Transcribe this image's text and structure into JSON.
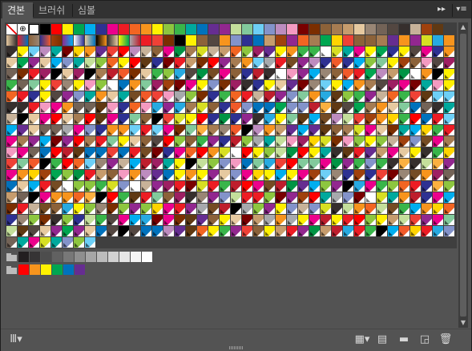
{
  "tabs": [
    {
      "label": "견본",
      "active": true
    },
    {
      "label": "브러쉬",
      "active": false
    },
    {
      "label": "심볼",
      "active": false
    }
  ],
  "toolbar": {
    "collapse_icon": "double-chevron-right-icon",
    "menu_icon": "panel-menu-icon",
    "collapse_glyph": "▸▸",
    "menu_glyph": "▾≡"
  },
  "special_swatches": [
    {
      "name": "none-swatch"
    },
    {
      "name": "registration-swatch"
    },
    {
      "name": "white-swatch"
    },
    {
      "name": "black-swatch"
    }
  ],
  "top_row_colors": [
    "#ff0000",
    "#ffef00",
    "#00a651",
    "#00aeef",
    "#2e3192",
    "#ec008c",
    "#ed1c24",
    "#f26522",
    "#f7941d",
    "#fff200",
    "#8dc63f",
    "#39b54a",
    "#00a99d",
    "#0072bc",
    "#662d91",
    "#92278f",
    "#c4df9b",
    "#82ca9c",
    "#6dcff6",
    "#8393ca",
    "#bd8cbf",
    "#f49ac1",
    "#790000",
    "#7b2e00",
    "#8c6239",
    "#a67c52",
    "#c69c6d",
    "#e6c9a0",
    "#998675",
    "#736357",
    "#534741",
    "#362f2d",
    "#c7b299",
    "#a0410d",
    "#603913",
    "#754c24"
  ],
  "groups": [
    {
      "name": "grayscale-group",
      "colors": [
        "#231f20",
        "#363435",
        "#4d4d4d",
        "#616161",
        "#787878",
        "#8f8f8f",
        "#a6a6a6",
        "#bcbcbc",
        "#d2d2d2",
        "#e6e6e6",
        "#f5f5f5",
        "#ffffff"
      ]
    },
    {
      "name": "brights-group",
      "colors": [
        "#ff0000",
        "#f7941d",
        "#fff200",
        "#00a651",
        "#0072bc",
        "#662d91"
      ]
    }
  ],
  "footer": {
    "libraries_icon": "swatch-libraries-menu-icon",
    "kind_icon": "show-swatch-kinds-icon",
    "options_icon": "swatch-options-icon",
    "new_group_icon": "new-color-group-icon",
    "new_swatch_icon": "new-swatch-icon",
    "delete_icon": "delete-swatch-icon",
    "libraries_glyph": "Ⅲ▾",
    "kind_glyph": "▦▾",
    "options_glyph": "▤",
    "new_group_glyph": "▬",
    "new_swatch_glyph": "◲",
    "delete_glyph": "🗑"
  }
}
